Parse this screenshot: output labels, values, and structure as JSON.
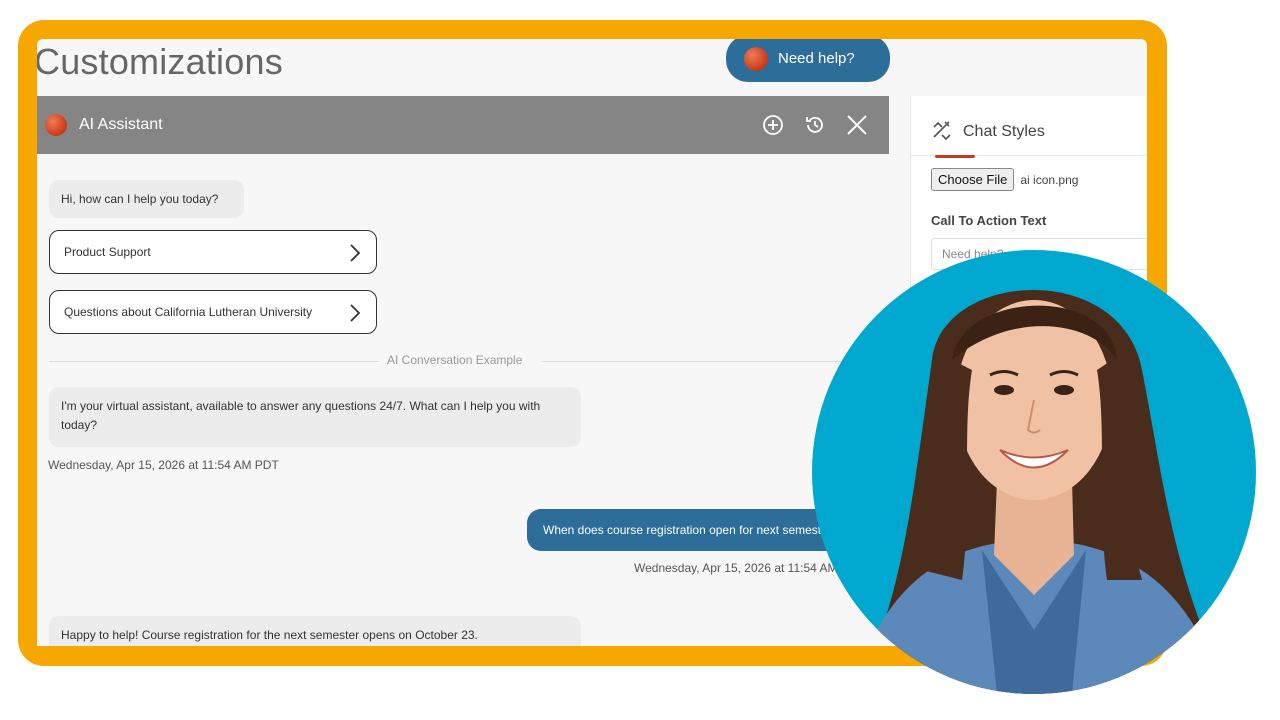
{
  "page": {
    "title": "Customizations"
  },
  "help_button": {
    "label": "Need help?"
  },
  "chat": {
    "title": "AI Assistant",
    "greeting": "Hi, how can I help you today?",
    "options": [
      "Product Support",
      "Questions about California Lutheran University"
    ],
    "divider_label": "AI Conversation Example",
    "assistant_message": "I'm your virtual assistant, available to answer any questions 24/7. What can I help you with today?",
    "assistant_timestamp": "Wednesday, Apr 15, 2026 at 11:54 AM PDT",
    "user_message": "When does course registration open for next semester?",
    "user_timestamp": "Wednesday, Apr 15, 2026 at 11:54 AM PDT",
    "reply_message": "Happy to help! Course registration for the next semester opens on October 23."
  },
  "side_panel": {
    "title": "Chat Styles",
    "choose_file_label": "Choose File",
    "file_name": "ai icon.png",
    "cta_label": "Call To Action Text",
    "cta_value": "Need help?"
  },
  "colors": {
    "frame": "#F6A800",
    "header": "#858585",
    "accent_blue": "#2d6d9a",
    "circle": "#00a8cf"
  }
}
